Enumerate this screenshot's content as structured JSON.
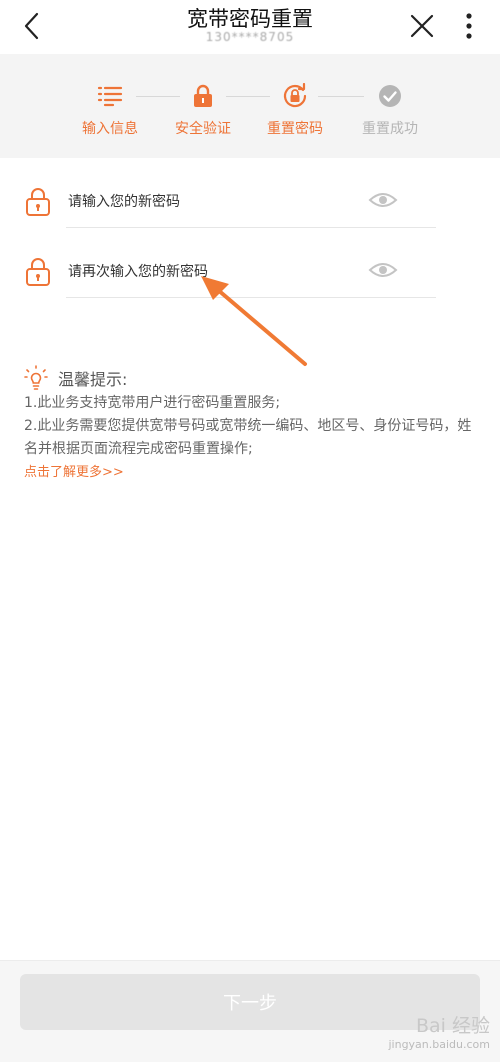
{
  "header": {
    "title": "宽带密码重置",
    "subtitle": "130****8705"
  },
  "steps": [
    {
      "label": "输入信息",
      "icon": "list-icon",
      "state": "active"
    },
    {
      "label": "安全验证",
      "icon": "lock-icon",
      "state": "active"
    },
    {
      "label": "重置密码",
      "icon": "lock-reset-icon",
      "state": "active"
    },
    {
      "label": "重置成功",
      "icon": "check-circle-icon",
      "state": "inactive"
    }
  ],
  "form": {
    "new_password_placeholder": "请输入您的新密码",
    "confirm_password_placeholder": "请再次输入您的新密码"
  },
  "tips": {
    "title": "温馨提示:",
    "line1": "1.此业务支持宽带用户进行密码重置服务;",
    "line2": "2.此业务需要您提供宽带号码或宽带统一编码、地区号、身份证号码，姓名并根据页面流程完成密码重置操作;",
    "more_link": "点击了解更多>>"
  },
  "bottom": {
    "next_label": "下一步"
  },
  "watermark": {
    "main": "Bai 经验",
    "sub": "jingyan.baidu.com"
  },
  "colors": {
    "accent": "#ee7437",
    "inactive": "#b5b5b5",
    "background": "#f4f4f4"
  }
}
